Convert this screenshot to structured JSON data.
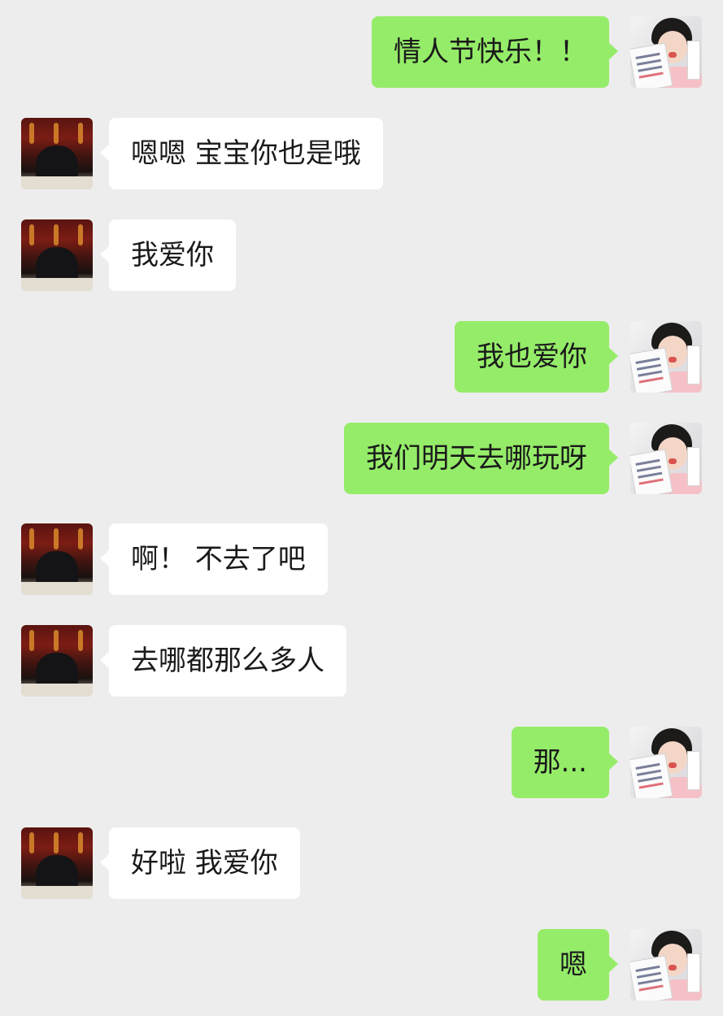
{
  "conversation": {
    "messages": [
      {
        "sender": "me",
        "text": "情人节快乐！！"
      },
      {
        "sender": "contact",
        "text": "嗯嗯 宝宝你也是哦"
      },
      {
        "sender": "contact",
        "text": "我爱你"
      },
      {
        "sender": "me",
        "text": "我也爱你"
      },
      {
        "sender": "me",
        "text": "我们明天去哪玩呀"
      },
      {
        "sender": "contact",
        "text": "啊！ 不去了吧"
      },
      {
        "sender": "contact",
        "text": "去哪都那么多人"
      },
      {
        "sender": "me",
        "text": "那..."
      },
      {
        "sender": "contact",
        "text": "好啦 我爱你"
      },
      {
        "sender": "me",
        "text": "嗯"
      }
    ]
  },
  "theme": {
    "background": "#ededed",
    "outgoing_bubble": "#95ec69",
    "incoming_bubble": "#ffffff",
    "text": "#1a1a1a"
  }
}
